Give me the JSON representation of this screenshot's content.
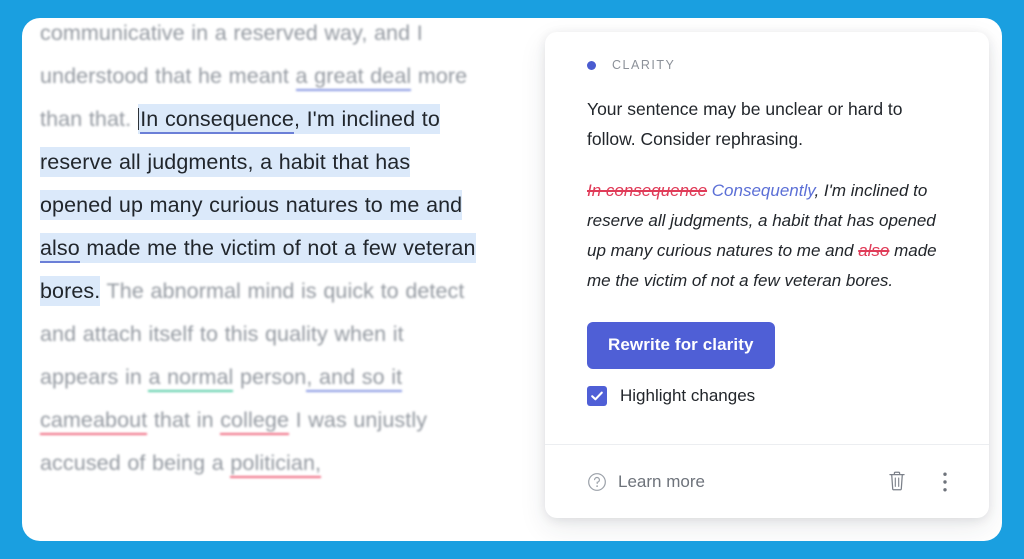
{
  "theme": {
    "frame_color": "#1a9fe0",
    "accent_color": "#4f5fd6",
    "highlight_color": "#dbe9fa",
    "delete_color": "#e03b58",
    "insert_color": "#5b6fd6",
    "underline_blue": "#6b7fd7",
    "underline_green": "#49c9a0",
    "underline_red": "#ef5e76"
  },
  "document": {
    "lines": [
      {
        "text": "communicative in a reserved way, and I",
        "state": "blurred"
      },
      {
        "text": "understood that he meant a great deal",
        "state": "blurred",
        "marked": "a great deal",
        "mark_color": "blue"
      },
      {
        "text": "more than that.",
        "state": "blurred"
      }
    ],
    "before_active": "more than that.",
    "active_sentence": "In consequence, I'm inclined to reserve all judgments, a habit that has opened up many curious natures to me and also made me the victim of not a few veteran bores.",
    "active_parts": {
      "mark_1": "In consequence",
      "mark_1_color": "blue",
      "mid_1": ", I'm inclined to reserve all judgments, a habit that has opened up many curious natures to me and ",
      "mark_2": "also",
      "mark_2_color": "blue",
      "tail": " made me the victim of not a few veteran bores."
    },
    "after_active_segments": [
      {
        "text": " The abnormal mind is quick to detect and attach itself to this quality when it appears in ",
        "mark": null
      },
      {
        "text": "a normal",
        "mark": "green"
      },
      {
        "text": " person",
        "mark": null
      },
      {
        "text": ", and so it",
        "mark": "blue"
      },
      {
        "text": " ",
        "mark": null
      },
      {
        "text": "cameabout",
        "mark": "red"
      },
      {
        "text": " that in ",
        "mark": null
      },
      {
        "text": "college",
        "mark": "red"
      },
      {
        "text": " I was unjustly accused of being a ",
        "mark": null
      },
      {
        "text": "politician,",
        "mark": "red"
      }
    ]
  },
  "card": {
    "category": "CLARITY",
    "category_dot": "bullet-dot",
    "explanation": "Your sentence may be unclear or hard to follow. Consider rephrasing.",
    "preview": {
      "deleted_1": "In consequence",
      "inserted_1": "Consequently",
      "mid": ", I'm inclined to reserve all judgments, a habit that has opened up many curious natures to me and ",
      "deleted_2": "also",
      "tail": " made me the victim of not a few veteran bores."
    },
    "rewrite_button": "Rewrite for clarity",
    "highlight_changes_label": "Highlight changes",
    "highlight_changes_checked": "checked",
    "learn_more_label": "Learn more",
    "learn_more_icon": "question-circle-icon",
    "delete_icon": "trash-icon",
    "more_icon": "kebab-menu-icon"
  }
}
